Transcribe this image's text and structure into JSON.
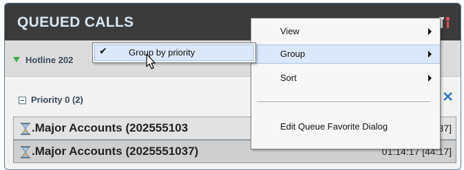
{
  "header": {
    "title": "QUEUED CALLS",
    "tools_icon": "tools-icon"
  },
  "queue": {
    "name": "Hotline 202",
    "expand_icon": "triangle-down-icon",
    "close_icon": "close-icon",
    "close_symbol": "✕"
  },
  "priority_group": {
    "label": "Priority 0 (2)",
    "collapse_icon": "minus-box-icon"
  },
  "calls": [
    {
      "name": ".Major Accounts (202555103",
      "time": "37]",
      "icon": "hourglass-icon"
    },
    {
      "name": ".Major Accounts (2025551037)",
      "time": "01:14:17  [44:17]",
      "icon": "hourglass-icon"
    }
  ],
  "context_menu": {
    "items": [
      {
        "label": "View",
        "has_submenu": true
      },
      {
        "label": "Group",
        "has_submenu": true,
        "highlighted": true
      },
      {
        "label": "Sort",
        "has_submenu": true
      },
      {
        "label": "Edit Queue Favorite Dialog",
        "has_submenu": false
      }
    ]
  },
  "group_submenu": {
    "items": [
      {
        "label": "Group by priority",
        "checked": true,
        "check_symbol": "✔"
      }
    ]
  },
  "colors": {
    "header_bg": "#3b3b3b",
    "title": "#d7e7f3",
    "accent_blue": "#2f78c4",
    "green_triangle": "#3fae3f",
    "menu_highlight": "#dbe8fb"
  }
}
